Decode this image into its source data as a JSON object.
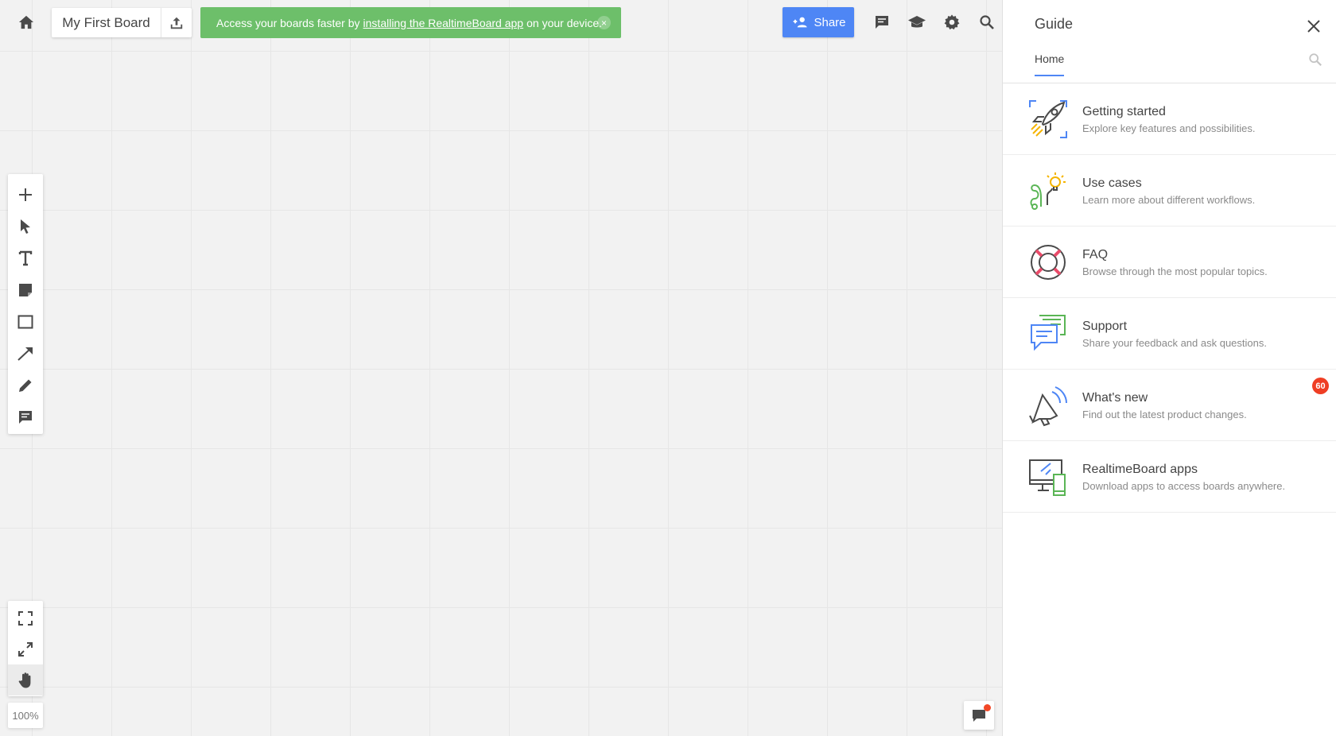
{
  "board": {
    "title": "My First Board"
  },
  "banner": {
    "text_before": "Access your boards faster by",
    "link_text": "installing the RealtimeBoard app",
    "text_after": "on your device.",
    "close_label": "×"
  },
  "share": {
    "label": "Share"
  },
  "zoom": {
    "level": "100%"
  },
  "guide": {
    "title": "Guide",
    "tab_home": "Home",
    "items": [
      {
        "title": "Getting started",
        "desc": "Explore key features and possibilities.",
        "icon": "rocket-icon"
      },
      {
        "title": "Use cases",
        "desc": "Learn more about different workflows.",
        "icon": "lightbulb-path-icon"
      },
      {
        "title": "FAQ",
        "desc": "Browse through the most popular topics.",
        "icon": "lifebuoy-icon"
      },
      {
        "title": "Support",
        "desc": "Share your feedback and ask questions.",
        "icon": "chat-bubbles-icon"
      },
      {
        "title": "What's new",
        "desc": "Find out the latest product changes.",
        "icon": "megaphone-icon",
        "badge": "60"
      },
      {
        "title": "RealtimeBoard apps",
        "desc": "Download apps to access boards anywhere.",
        "icon": "devices-icon"
      }
    ]
  },
  "colors": {
    "accent": "#4e86f5",
    "banner": "#6dbf6a",
    "badge": "#ef3e24"
  }
}
